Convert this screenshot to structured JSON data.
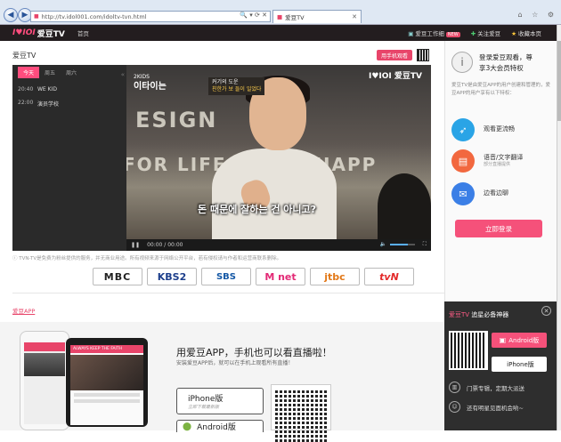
{
  "browser": {
    "url": "http://tv.idol001.com/idoltv-tvn.html",
    "tab_title": "爱豆TV",
    "back": "◀",
    "forward": "▶",
    "address_tools": "🔍 ▾ ⟳ ✕",
    "tab_close": "✕",
    "window_tools": "⌂ ☆ ⚙"
  },
  "header": {
    "logo": "I♥IOI",
    "logo_cn": "爱豆TV",
    "home": "首页",
    "workbench": "爱豆工作细",
    "workbench_badge": "NEW",
    "follow": "关注爱豆",
    "bookmark": "收藏本页"
  },
  "main": {
    "title": "爱豆TV",
    "watch_phone": "用手机观看",
    "schedule": {
      "tabs": [
        "今天",
        "周五",
        "周六"
      ],
      "rows": [
        {
          "time": "20:40",
          "show": "WE KID"
        },
        {
          "time": "22:00",
          "show": "演员学校"
        }
      ]
    },
    "player": {
      "tv_logo": "I♥IOI 爱豆TV",
      "show_logo_small": "2KIDS",
      "show_logo_big": "이타이는",
      "caption_top": "커기의 도운",
      "caption_bottom": "친한가 보 들이 일었다",
      "subtitle": "돈 때문에 잘하는 건 아니고?",
      "time": "00:00 / 00:00",
      "wall_1": "ESIGN",
      "wall_2": "FOR LIFE AND A HAPP"
    },
    "notice": "TVN-TV是免费为粉丝提供的服务，并无商业用途。所有视频来源于网络公开平台，若有侵权请与作者和运营商联系删除。",
    "channels": [
      "MBC",
      "KBS2",
      "SBS",
      "M net",
      "jtbc",
      "tvN"
    ],
    "app_link": "爱豆APP",
    "promo": {
      "title": "用爱豆APP，手机也可以看直播啦！",
      "subtitle": "安装爱豆APP后，就可以在手机上观看所有直播！",
      "iphone": "iPhone版",
      "iphone_sub": "立即下载最新版",
      "android": "Android版",
      "phone_bar": "爱豆TV",
      "phone_b_bar": "ALWAYS KEEP THE FAITH"
    }
  },
  "sidebar": {
    "login_title_1": "登录爱豆观看，尊",
    "login_title_2": "享3大会员特权",
    "login_desc": "爱豆TV是由爱豆APP的用户创建和管理的，爱豆APP的用户享有以下特权：",
    "features": [
      {
        "label": "观看更流畅",
        "sub": "",
        "color": "#2aa4e6"
      },
      {
        "label": "语音/文字翻译",
        "sub": "部分直播提供",
        "color": "#f2683f"
      },
      {
        "label": "边看边聊",
        "sub": "",
        "color": "#3b7fe6"
      }
    ],
    "login_btn": "立即登录",
    "app_panel": {
      "title_pink": "爱豆TV",
      "title_rest": "追星必备神器",
      "android": "Android版",
      "ios": "iPhone版",
      "row1": "门票专辑，定期大派送",
      "row2": "还有明星见面机会哟~"
    }
  }
}
